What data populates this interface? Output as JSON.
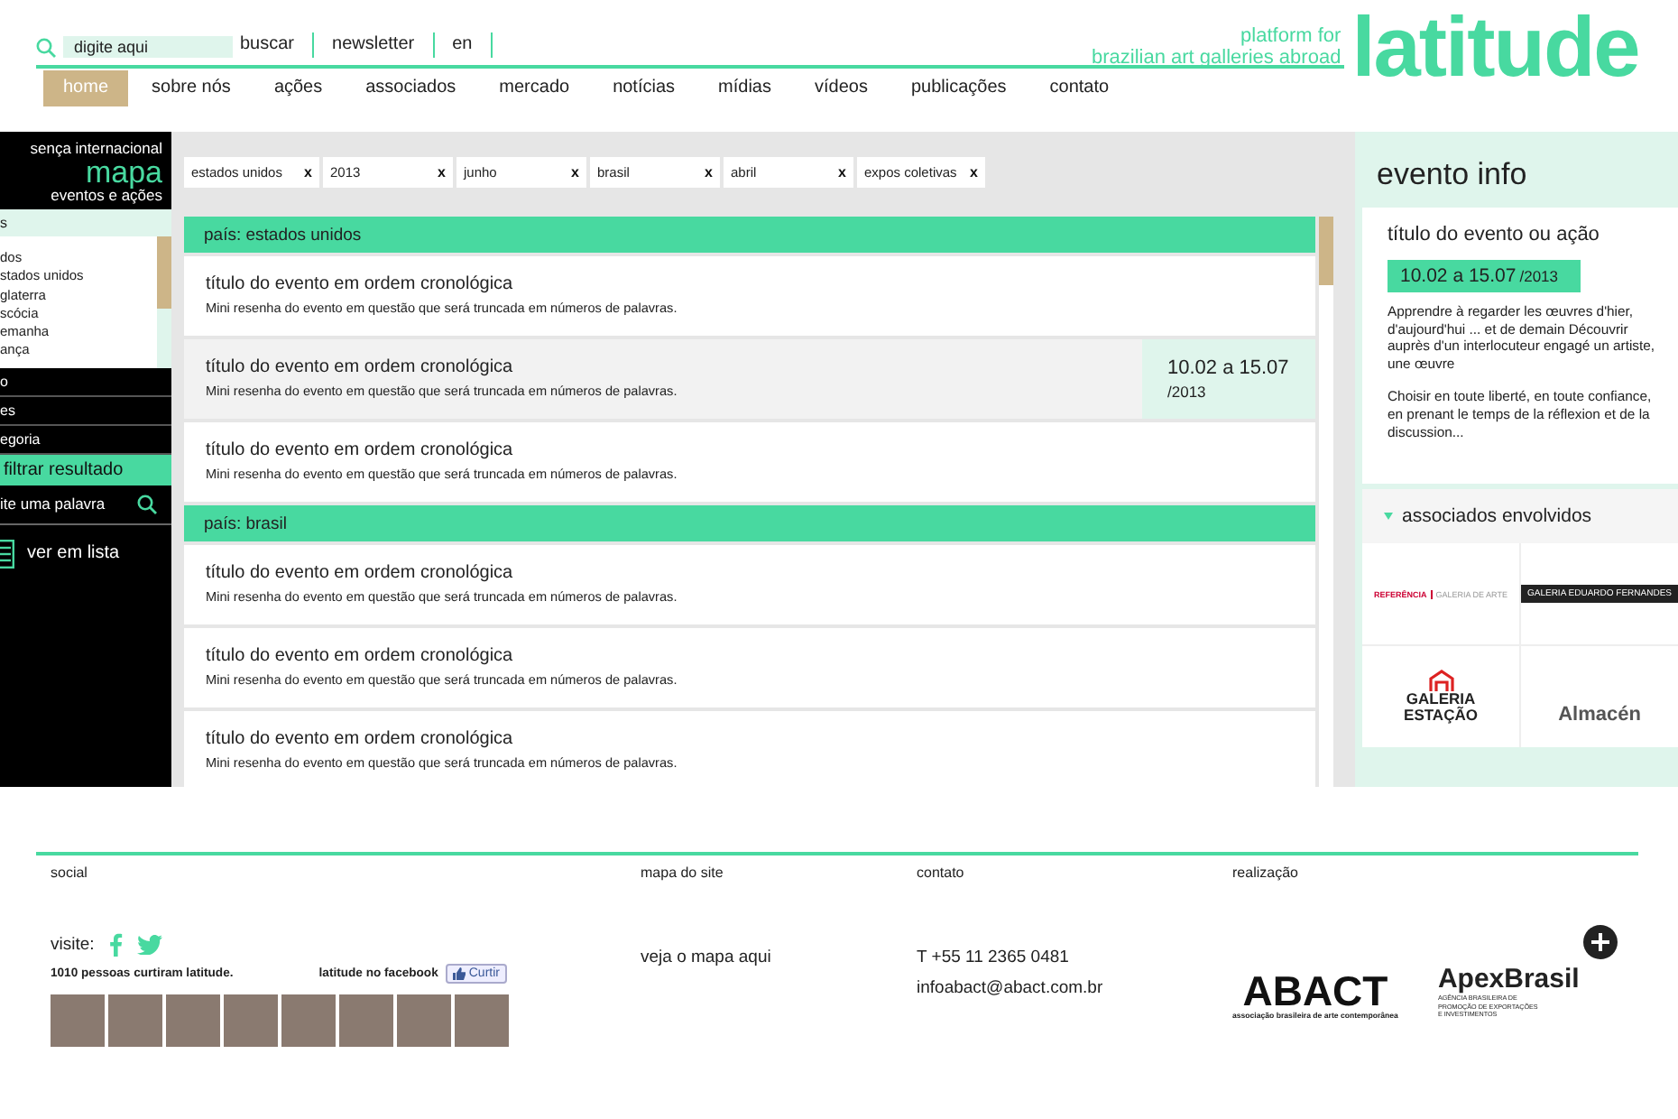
{
  "header": {
    "search": {
      "placeholder": "digite aqui"
    },
    "links": [
      "buscar",
      "newsletter",
      "en"
    ],
    "tagline": [
      "platform for",
      "brazilian art galleries abroad"
    ],
    "logo": "latitude"
  },
  "nav": [
    {
      "label": "home",
      "selected": true
    },
    {
      "label": "sobre nós",
      "selected": false
    },
    {
      "label": "ações",
      "selected": false
    },
    {
      "label": "associados",
      "selected": false
    },
    {
      "label": "mercado",
      "selected": false
    },
    {
      "label": "notícias",
      "selected": false
    },
    {
      "label": "mídias",
      "selected": false
    },
    {
      "label": "vídeos",
      "selected": false
    },
    {
      "label": "publicações",
      "selected": false
    },
    {
      "label": "contato",
      "selected": false
    }
  ],
  "sidebar": {
    "heading": [
      "sença internacional",
      "mapa",
      "eventos e ações"
    ],
    "filters": [
      {
        "label": "s",
        "expanded": true,
        "options": [
          "dos",
          "stados unidos",
          "glaterra",
          "scócia",
          "emanha",
          "ança"
        ]
      },
      {
        "label": "o",
        "expanded": false
      },
      {
        "label": "es",
        "expanded": false
      },
      {
        "label": "egoria",
        "expanded": false
      }
    ],
    "filter_button": "filtrar resultado",
    "search": {
      "placeholder": "ite uma palavra"
    },
    "view_toggle": "ver em lista"
  },
  "chips": [
    {
      "label": "estados unidos",
      "remove": "x"
    },
    {
      "label": "2013",
      "remove": "x"
    },
    {
      "label": "junho",
      "remove": "x"
    },
    {
      "label": "brasil",
      "remove": "x"
    },
    {
      "label": "abril",
      "remove": "x"
    },
    {
      "label": "expos coletivas",
      "remove": "x"
    }
  ],
  "groups": [
    {
      "title": "país: estados unidos",
      "rows": [
        {
          "title": "título do evento em ordem cronológica",
          "summary": "Mini resenha do evento em questão que será truncada em números de palavras.",
          "selected": false
        },
        {
          "title": "título do evento em ordem cronológica",
          "summary": "Mini resenha do evento em questão que será truncada em números de palavras.",
          "selected": true,
          "date": "10.02 a 15.07",
          "year": "/2013"
        },
        {
          "title": "título do evento em ordem cronológica",
          "summary": "Mini resenha do evento em questão que será truncada em números de palavras.",
          "selected": false
        }
      ]
    },
    {
      "title": "país: brasil",
      "rows": [
        {
          "title": "título do evento em ordem cronológica",
          "summary": "Mini resenha do evento em questão que será truncada em números de palavras.",
          "selected": false
        },
        {
          "title": "título do evento em ordem cronológica",
          "summary": "Mini resenha do evento em questão que será truncada em números de palavras.",
          "selected": false
        },
        {
          "title": "título do evento em ordem cronológica",
          "summary": "Mini resenha do evento em questão que será truncada em números de palavras.",
          "selected": false
        }
      ]
    }
  ],
  "event_info": {
    "heading": "evento info",
    "title": "título do evento ou ação",
    "date": "10.02 a 15.07",
    "year": "/2013",
    "paragraphs": [
      "Apprendre à regarder les œuvres d'hier, d'aujourd'hui ... et de demain Découvrir auprès d'un interlocuteur engagé un artiste, une œuvre",
      "Choisir en toute liberté, en toute confiance, en prenant le temps de la réflexion et de la discussion..."
    ],
    "associates_heading": "associados envolvidos",
    "associates": [
      {
        "kind": "referencia",
        "name": "REFERÊNCIA",
        "subtitle": "GALERIA DE ARTE"
      },
      {
        "kind": "dark",
        "name": "GALERIA EDUARDO FERNANDES"
      },
      {
        "kind": "estacao",
        "name": "GALERIA",
        "subtitle": "ESTAÇÃO"
      },
      {
        "kind": "almacen",
        "name": "Almacén"
      }
    ]
  },
  "footer": {
    "columns": [
      "social",
      "mapa do site",
      "contato",
      "realização"
    ],
    "social": {
      "visit_label": "visite:",
      "likes": "1010 pessoas curtiram latitude.",
      "facebook_label": "latitude no facebook",
      "like_button": "Curtir",
      "fans": [
        {
          "kind": "photo"
        },
        {
          "kind": "photo"
        },
        {
          "kind": "photo"
        },
        {
          "kind": "photo"
        },
        {
          "kind": "photo"
        },
        {
          "kind": "photo"
        },
        {
          "kind": "photo"
        },
        {
          "kind": "photo"
        }
      ]
    },
    "sitemap_link": "veja o mapa aqui",
    "phone": "T +55 11 2365 0481",
    "email": "infoabact@abact.com.br",
    "sponsors": [
      {
        "kind": "abact",
        "name": "ABACT",
        "subtitle": "associação brasileira de arte contemporânea"
      },
      {
        "kind": "apex",
        "name": "ApexBrasil",
        "subtitle": "AGÊNCIA BRASILEIRA DE PROMOÇÃO DE EXPORTAÇÕES E INVESTIMENTOS"
      }
    ]
  }
}
